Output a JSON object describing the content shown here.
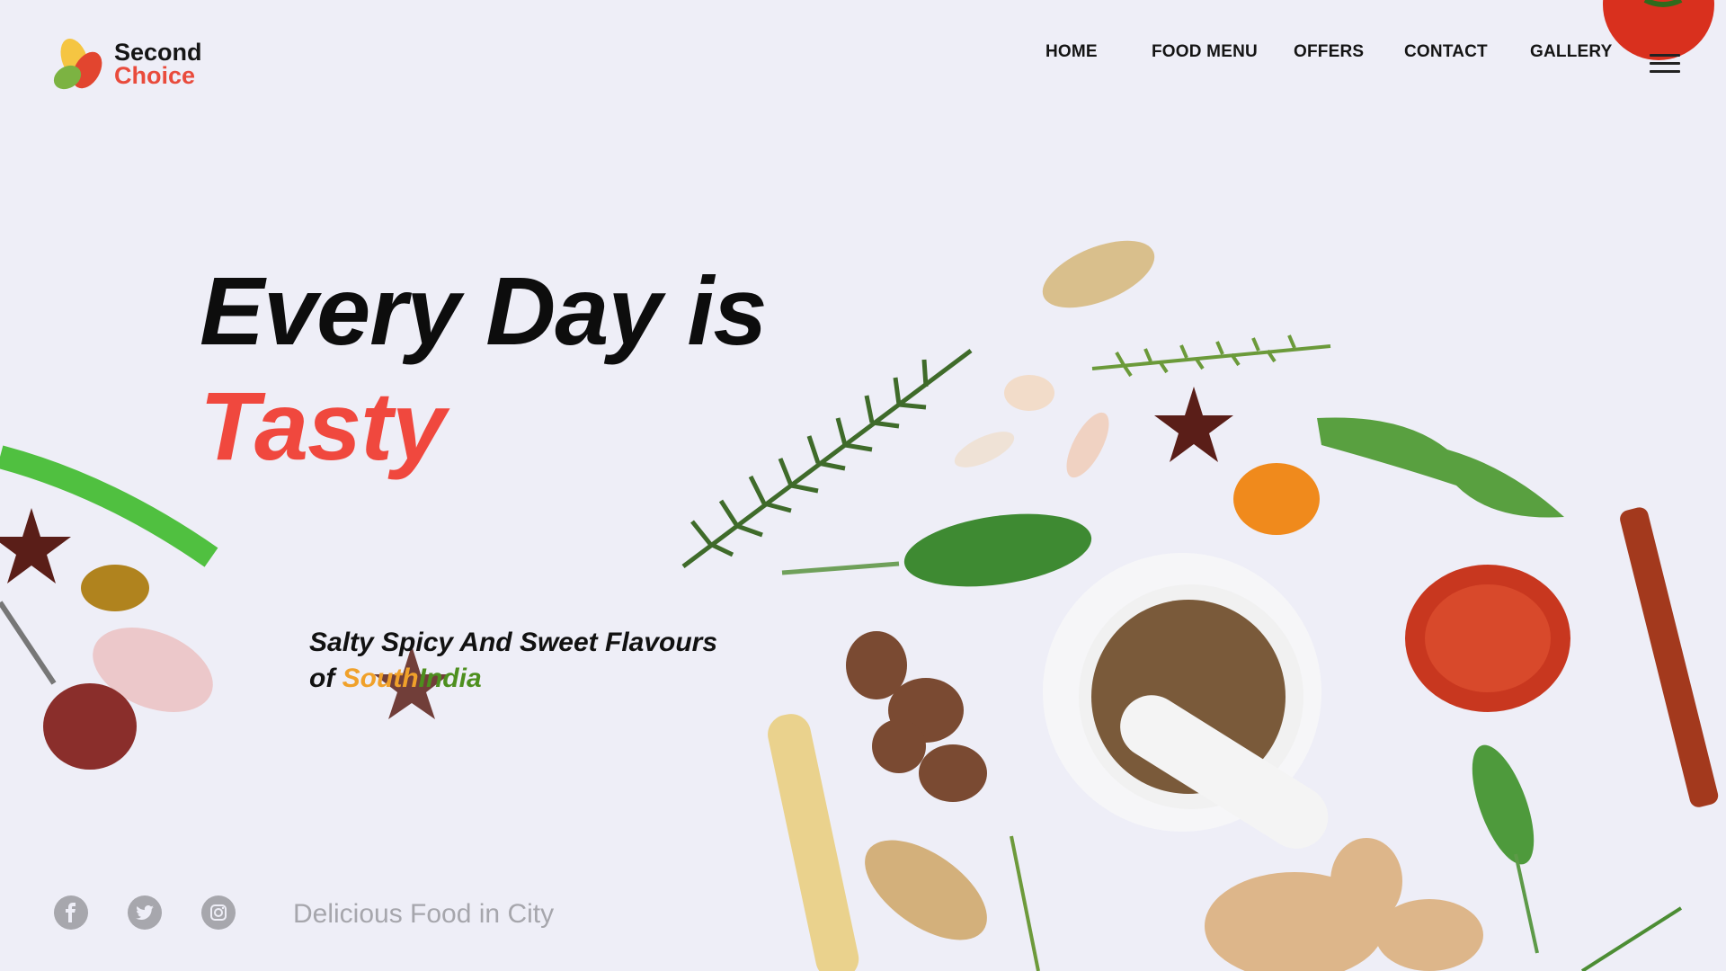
{
  "brand": {
    "line1": "Second",
    "line2": "Choice"
  },
  "nav": {
    "items": [
      "HOME",
      "FOOD MENU",
      "OFFERS",
      "CONTACT",
      "GALLERY"
    ]
  },
  "hero": {
    "title_line1": "Every Day is",
    "title_line2": "Tasty"
  },
  "tagline": {
    "line1": "Salty Spicy And Sweet Flavours",
    "prefix": "of ",
    "south": "South",
    "india": "India"
  },
  "footer": {
    "text": "Delicious Food in City",
    "social_icons": [
      "facebook-icon",
      "twitter-icon",
      "instagram-icon"
    ]
  },
  "colors": {
    "background": "#eeeef7",
    "accent": "#f0483e",
    "south": "#f0a12a",
    "india": "#4d8f1e"
  }
}
